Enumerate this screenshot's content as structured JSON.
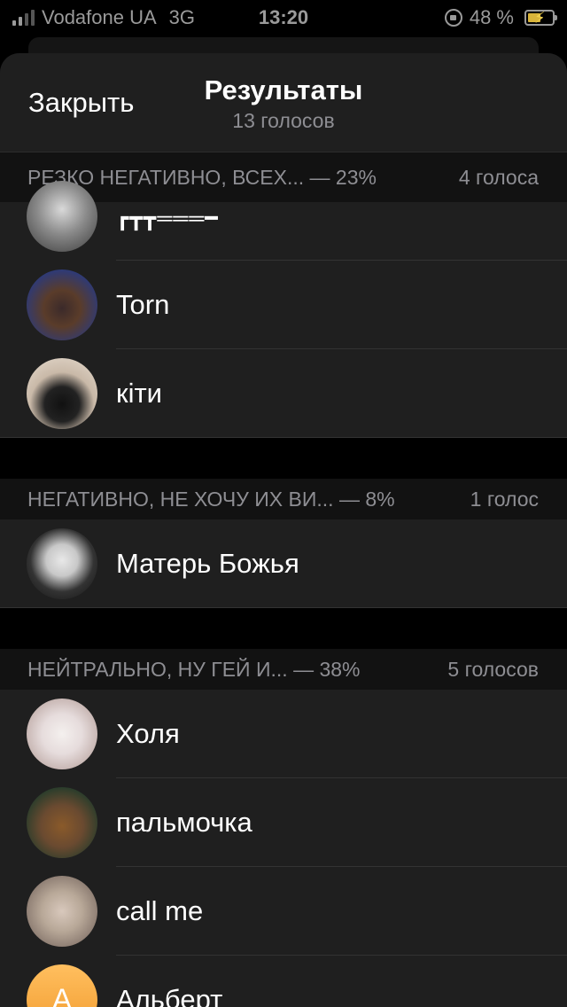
{
  "status_bar": {
    "carrier": "Vodafone UA",
    "network": "3G",
    "time": "13:20",
    "battery": "48 %"
  },
  "header": {
    "close_label": "Закрыть",
    "title": "Результаты",
    "subtitle": "13 голосов"
  },
  "sections": [
    {
      "title": "РЕЗКО НЕГАТИВНО, ВСЕХ... — 23%",
      "count": "4 голоса",
      "voters": [
        {
          "name": "┏┳┳═══━",
          "avatar": "bw-photo"
        },
        {
          "name": "Torn",
          "avatar": "torn-photo"
        },
        {
          "name": "кіти",
          "avatar": "cat-photo"
        }
      ]
    },
    {
      "title": "НЕГАТИВНО, НЕ ХОЧУ ИХ ВИ... — 8%",
      "count": "1 голос",
      "voters": [
        {
          "name": "Матерь Божья",
          "avatar": "girl-photo"
        }
      ]
    },
    {
      "title": "НЕЙТРАЛЬНО, НУ ГЕЙ И... — 38%",
      "count": "5 голосов",
      "voters": [
        {
          "name": "Холя",
          "avatar": "kitten-photo"
        },
        {
          "name": "пальмочка",
          "avatar": "hamster-photo"
        },
        {
          "name": "call me",
          "avatar": "boy-photo"
        },
        {
          "name": "Альберт",
          "avatar": "A"
        }
      ]
    }
  ],
  "colors": {
    "sheet_bg": "#1f1f1f",
    "section_header_text": "#8e8e93",
    "letter_avatar": "#f5a33a"
  }
}
